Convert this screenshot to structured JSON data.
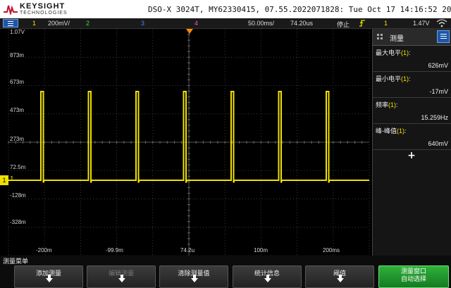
{
  "header": {
    "brand": "KEYSIGHT",
    "brand_sub": "TECHNOLOGIES",
    "device_info": "DSO-X 3024T, MY62330415, 07.55.2022071828: Tue Oct 17 14:16:52 2023"
  },
  "channel_bar": {
    "ch1_num": "1",
    "ch1_scale": "200mV/",
    "ch2_num": "2",
    "ch3_num": "3",
    "ch4_num": "4",
    "time_scale": "50.00ms/",
    "time_delay": "74.20us",
    "run_state": "停止",
    "trigger_icon": "rising-edge-trigger-icon",
    "trigger_source": "1",
    "trigger_level": "1.47V"
  },
  "graticule": {
    "volt_labels": [
      "1.07V",
      "873m",
      "673m",
      "473m",
      "273m",
      "72.5m",
      "-128m",
      "-328m"
    ],
    "time_labels": [
      "-200m",
      "-99.9m",
      "74.2u",
      "100m",
      "200ms"
    ],
    "ch1_marker": "1",
    "ch1_ground": "1"
  },
  "waveform": {
    "color": "#f0e000",
    "baseline_v": 0.0,
    "pulse_high_v": 0.626,
    "pulse_low_v": -0.017,
    "frequency_hz": 15.259
  },
  "right_panel": {
    "title": "测量",
    "measurements": [
      {
        "label": "最大电平",
        "ch": "(1)",
        "colon": ":",
        "value": "626mV"
      },
      {
        "label": "最小电平",
        "ch": "(1)",
        "colon": ":",
        "value": "-17mV"
      },
      {
        "label": "频率",
        "ch": "(1)",
        "colon": ":",
        "value": "15.259Hz"
      },
      {
        "label": "峰-峰值",
        "ch": "(1)",
        "colon": ":",
        "value": "640mV"
      }
    ],
    "add_label": "+"
  },
  "softkeys": {
    "title": "测量菜单",
    "keys": [
      {
        "label": "添加测量",
        "enabled": true
      },
      {
        "label": "编辑测量",
        "enabled": false
      },
      {
        "label": "清除测量值",
        "enabled": true
      },
      {
        "label": "统计信息",
        "enabled": true
      },
      {
        "label": "阈值",
        "enabled": true
      },
      {
        "label_line1": "测量窗口",
        "label_line2": "自动选择",
        "enabled": true
      }
    ]
  },
  "colors": {
    "ch1": "#f0e000",
    "ch2": "#3ddc3d",
    "ch3": "#4f7cff",
    "ch4": "#ff4fb0",
    "accent": "#1e56a8",
    "trigger_marker": "#ff8c00"
  }
}
